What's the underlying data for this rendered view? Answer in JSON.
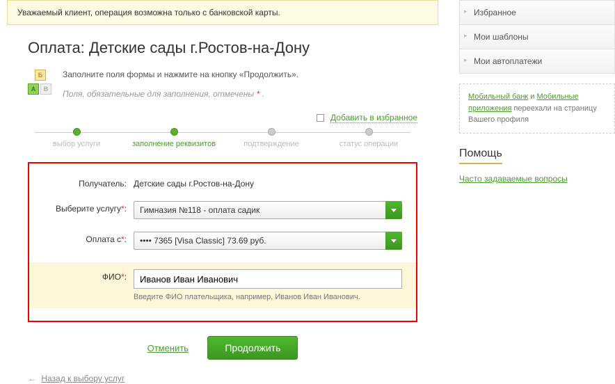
{
  "alert_text": "Уважаемый клиент, операция возможна только с банковской карты.",
  "page_title": "Оплата: Детские сады г.Ростов-на-Дону",
  "instructions": {
    "line1": "Заполните поля формы и нажмите на кнопку «Продолжить».",
    "line2": "Поля, обязательные для заполнения, отмечены ",
    "star": "*"
  },
  "favorite_label": "Добавить в избранное",
  "steps": {
    "s1": "выбор услуги",
    "s2": "заполнение реквизитов",
    "s3": "подтверждение",
    "s4": "статус операции"
  },
  "form": {
    "recipient": {
      "label": "Получатель:",
      "value": "Детские сады г.Ростов-на-Дону"
    },
    "service": {
      "label": "Выберите услугу",
      "star": "*",
      "value": "Гимназия №118 - оплата садик"
    },
    "payfrom": {
      "label": "Оплата с",
      "star": "*",
      "value": "•••• 7365 [Visa Classic] 73.69 руб."
    },
    "fio": {
      "label": "ФИО",
      "star": "*",
      "value": "Иванов Иван Иванович",
      "hint": "Введите ФИО плательщика, например, Иванов Иван Иванович."
    }
  },
  "actions": {
    "cancel": "Отменить",
    "continue": "Продолжить"
  },
  "back_link": "Назад к выбору услуг",
  "sidebar": {
    "menu": {
      "favorites": "Избранное",
      "templates": "Мои шаблоны",
      "autopay": "Мои автоплатежи"
    },
    "note": {
      "link1": "Мобильный банк",
      "and": " и ",
      "link2": "Мобильные приложения",
      "text": " переехали на страницу Вашего профиля"
    },
    "help": {
      "title": "Помощь",
      "faq": "Часто задаваемые вопросы"
    }
  }
}
